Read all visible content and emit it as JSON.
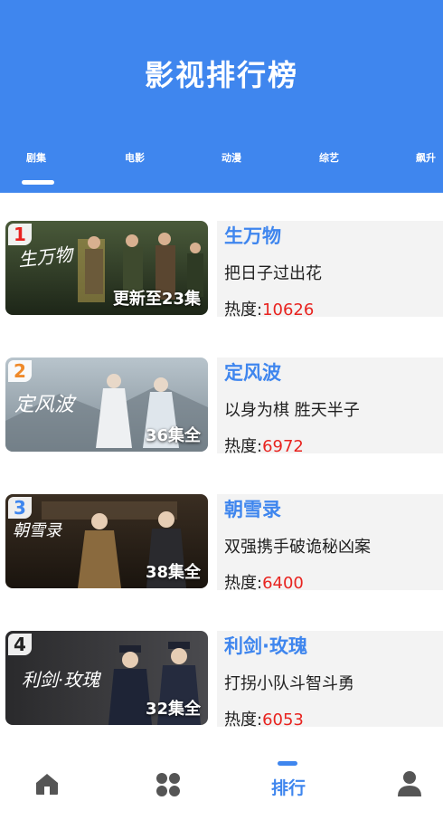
{
  "header": {
    "title": "影视排行榜"
  },
  "tabs": [
    "剧集",
    "电影",
    "动漫",
    "综艺",
    "飙升"
  ],
  "ranking": [
    {
      "rank": "1",
      "rank_color": "#e8231f",
      "poster_text": "生万物",
      "name": "生万物",
      "desc": "把日子过出花",
      "heat_label": "热度:",
      "heat": "10626",
      "episodes": "更新至23集"
    },
    {
      "rank": "2",
      "rank_color": "#ef8a2a",
      "poster_text": "定风波",
      "name": "定风波",
      "desc": "以身为棋 胜天半子",
      "heat_label": "热度:",
      "heat": "6972",
      "episodes": "36集全"
    },
    {
      "rank": "3",
      "rank_color": "#3f86ee",
      "poster_text": "朝雪录",
      "name": "朝雪录",
      "desc": "双强携手破诡秘凶案",
      "heat_label": "热度:",
      "heat": "6400",
      "episodes": "38集全"
    },
    {
      "rank": "4",
      "rank_color": "#222222",
      "poster_text": "利剑·玫瑰",
      "name": "利剑·玫瑰",
      "desc": "打拐小队斗智斗勇",
      "heat_label": "热度:",
      "heat": "6053",
      "episodes": "32集全"
    }
  ],
  "nav": {
    "items": [
      {
        "icon": "home-icon"
      },
      {
        "icon": "apps-icon"
      },
      {
        "icon": "ranking-icon",
        "label": "排行",
        "active": true
      },
      {
        "icon": "user-icon"
      }
    ]
  },
  "colors": {
    "primary": "#3f86ee",
    "heat": "#e8231f",
    "inactive_icon": "#555555"
  }
}
